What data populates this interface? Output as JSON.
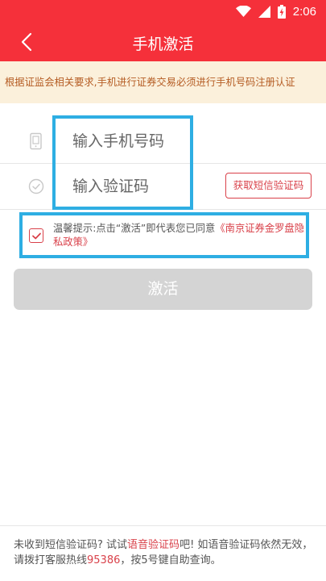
{
  "status_bar": {
    "time": "2:06",
    "icons": [
      "wifi-icon",
      "signal-icon",
      "battery-icon"
    ]
  },
  "header": {
    "title": "手机激活",
    "back_icon": "back-arrow-icon"
  },
  "notice": {
    "text": "根据证监会相关要求,手机进行证券交易必须进行手机号码注册认证"
  },
  "form": {
    "phone_placeholder": "输入手机号码",
    "phone_value": "",
    "phone_icon": "phone-icon",
    "code_placeholder": "输入验证码",
    "code_value": "",
    "code_icon": "shield-check-icon",
    "get_code_label": "获取短信验证码"
  },
  "agreement": {
    "checked": true,
    "text_prefix": "温馨提示:点击“激活”即代表您已同意",
    "policy_link": "《南京证券金罗盘隐私政策》"
  },
  "activate_button": {
    "label": "激活"
  },
  "footer": {
    "part1": "未收到短信验证码? 试试",
    "voice_link": "语音验证码",
    "part2": "吧! 如语音验证码依然无效，请拨打客服热线",
    "hotline": "95386",
    "part3": "，按5号键自助查询。"
  },
  "colors": {
    "brand_red": "#f5303a",
    "accent_red": "#d9414a",
    "notice_bg": "#fbf0db",
    "notice_text": "#b55c23",
    "highlight_blue": "#2eaee3",
    "disabled_gray": "#d4d4d4"
  }
}
